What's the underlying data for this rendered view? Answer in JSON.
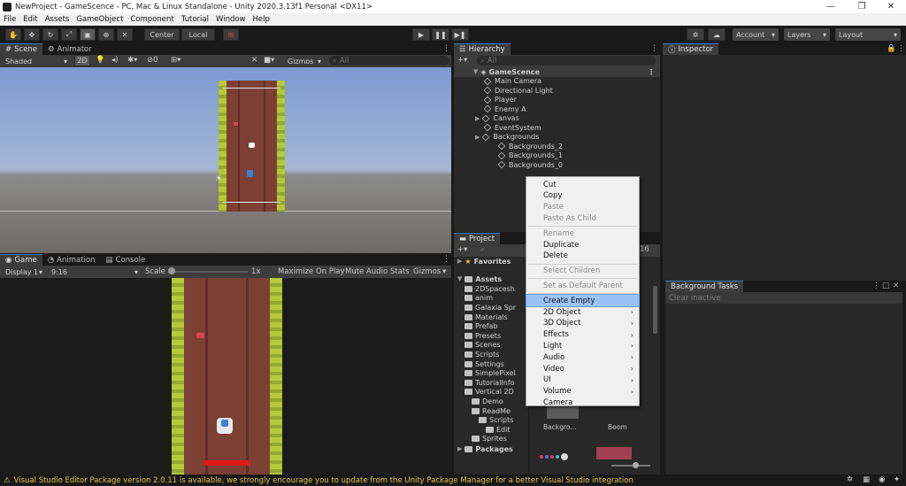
{
  "window": {
    "title": "NewProject - GameScence - PC, Mac & Linux Standalone - Unity 2020.3.13f1 Personal <DX11>",
    "minimize": "—",
    "maximize": "❐",
    "close": "✕"
  },
  "menu": [
    "File",
    "Edit",
    "Assets",
    "GameObject",
    "Component",
    "Tutorial",
    "Window",
    "Help"
  ],
  "toolbar": {
    "pivot": "Center",
    "space": "Local",
    "account": "Account",
    "layers": "Layers",
    "layout": "Layout"
  },
  "scene_panel": {
    "tabs": [
      "Scene",
      "Animator"
    ],
    "shading": "Shaded",
    "mode_2d": "2D",
    "count": "0",
    "gizmos": "Gizmos",
    "search_placeholder": "All"
  },
  "game_panel": {
    "tabs": [
      "Game",
      "Animation",
      "Console"
    ],
    "display": "Display 1",
    "aspect": "9:16",
    "scale_label": "Scale",
    "scale_value": "1x",
    "maximize": "Maximize On Play",
    "mute": "Mute Audio",
    "stats": "Stats",
    "gizmos": "Gizmos"
  },
  "hierarchy": {
    "tab": "Hierarchy",
    "search_placeholder": "All",
    "scene": "GameScence",
    "items": [
      {
        "label": "Main Camera",
        "depth": 1,
        "expandable": false
      },
      {
        "label": "Directional Light",
        "depth": 1,
        "expandable": false
      },
      {
        "label": "Player",
        "depth": 1,
        "expandable": false
      },
      {
        "label": "Enemy A",
        "depth": 1,
        "expandable": false
      },
      {
        "label": "Canvas",
        "depth": 1,
        "expandable": true
      },
      {
        "label": "EventSystem",
        "depth": 1,
        "expandable": false
      },
      {
        "label": "Backgrounds",
        "depth": 1,
        "expandable": true
      },
      {
        "label": "Backgrounds_2",
        "depth": 2,
        "expandable": false
      },
      {
        "label": "Backgrounds_1",
        "depth": 2,
        "expandable": false
      },
      {
        "label": "Backgrounds_0",
        "depth": 2,
        "expandable": false
      }
    ]
  },
  "inspector": {
    "tab": "Inspector"
  },
  "project": {
    "tab": "Project",
    "count": "16",
    "favorites": "Favorites",
    "assets": "Assets",
    "folders": [
      {
        "label": "2DSpacesh",
        "depth": 1
      },
      {
        "label": "anim",
        "depth": 1
      },
      {
        "label": "Galaxia Spr",
        "depth": 1
      },
      {
        "label": "Materials",
        "depth": 1
      },
      {
        "label": "Prefab",
        "depth": 1
      },
      {
        "label": "Presets",
        "depth": 1
      },
      {
        "label": "Scenes",
        "depth": 1
      },
      {
        "label": "Scripts",
        "depth": 1
      },
      {
        "label": "Settings",
        "depth": 1
      },
      {
        "label": "SimplePixel",
        "depth": 1
      },
      {
        "label": "TutorialInfo",
        "depth": 1
      },
      {
        "label": "Vertical 2D",
        "depth": 1
      },
      {
        "label": "Demo",
        "depth": 2
      },
      {
        "label": "ReadMe",
        "depth": 2
      },
      {
        "label": "Scripts",
        "depth": 3
      },
      {
        "label": "Edit",
        "depth": 4
      },
      {
        "label": "Sprites",
        "depth": 2
      }
    ],
    "packages": "Packages",
    "thumbnails": [
      "Backgro...",
      "Boom"
    ]
  },
  "context_menu": {
    "items": [
      {
        "label": "Cut",
        "disabled": false,
        "submenu": false
      },
      {
        "label": "Copy",
        "disabled": false,
        "submenu": false
      },
      {
        "label": "Paste",
        "disabled": true,
        "submenu": false
      },
      {
        "label": "Paste As Child",
        "disabled": true,
        "submenu": false
      },
      {
        "sep": true
      },
      {
        "label": "Rename",
        "disabled": true,
        "submenu": false
      },
      {
        "label": "Duplicate",
        "disabled": false,
        "submenu": false
      },
      {
        "label": "Delete",
        "disabled": false,
        "submenu": false
      },
      {
        "sep": true
      },
      {
        "label": "Select Children",
        "disabled": true,
        "submenu": false
      },
      {
        "sep": true
      },
      {
        "label": "Set as Default Parent",
        "disabled": true,
        "submenu": false
      },
      {
        "sep": true
      },
      {
        "label": "Create Empty",
        "disabled": false,
        "submenu": false,
        "selected": true
      },
      {
        "label": "2D Object",
        "disabled": false,
        "submenu": true
      },
      {
        "label": "3D Object",
        "disabled": false,
        "submenu": true
      },
      {
        "label": "Effects",
        "disabled": false,
        "submenu": true
      },
      {
        "label": "Light",
        "disabled": false,
        "submenu": true
      },
      {
        "label": "Audio",
        "disabled": false,
        "submenu": true
      },
      {
        "label": "Video",
        "disabled": false,
        "submenu": true
      },
      {
        "label": "UI",
        "disabled": false,
        "submenu": true
      },
      {
        "label": "Volume",
        "disabled": false,
        "submenu": true
      },
      {
        "label": "Camera",
        "disabled": false,
        "submenu": false
      }
    ]
  },
  "background_tasks": {
    "tab": "Background Tasks",
    "status": "Clear inactive"
  },
  "status_bar": {
    "message": "Visual Studio Editor Package version 2.0.11 is available, we strongly encourage you to update from the Unity Package Manager for a better Visual Studio integration"
  },
  "colors": {
    "accent": "#3a79bb",
    "warning": "#e6c045",
    "menu_highlight": "#99c3f5"
  }
}
